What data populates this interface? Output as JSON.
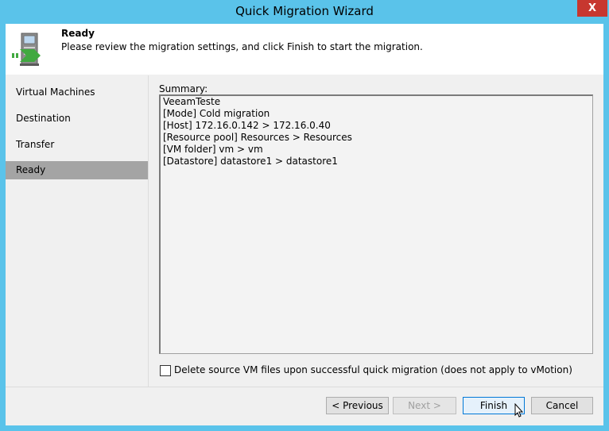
{
  "window": {
    "title": "Quick Migration Wizard",
    "close_label": "X"
  },
  "header": {
    "title": "Ready",
    "description": "Please review the migration settings, and click Finish to start the migration."
  },
  "steps": [
    {
      "label": "Virtual Machines"
    },
    {
      "label": "Destination"
    },
    {
      "label": "Transfer"
    },
    {
      "label": "Ready",
      "active": true
    }
  ],
  "summary": {
    "label": "Summary:",
    "lines": [
      "VeeamTeste",
      "[Mode] Cold migration",
      "[Host] 172.16.0.142 > 172.16.0.40",
      "[Resource pool] Resources > Resources",
      "[VM folder] vm > vm",
      "[Datastore] datastore1 > datastore1"
    ]
  },
  "options": {
    "delete_source_label": "Delete source VM files upon successful quick migration (does not apply to vMotion)",
    "delete_source_checked": false
  },
  "buttons": {
    "previous": "< Previous",
    "next": "Next >",
    "finish": "Finish",
    "cancel": "Cancel"
  },
  "colors": {
    "title_bar": "#5ac3ea",
    "close_button": "#c7372f",
    "active_step": "#a4a4a4"
  }
}
